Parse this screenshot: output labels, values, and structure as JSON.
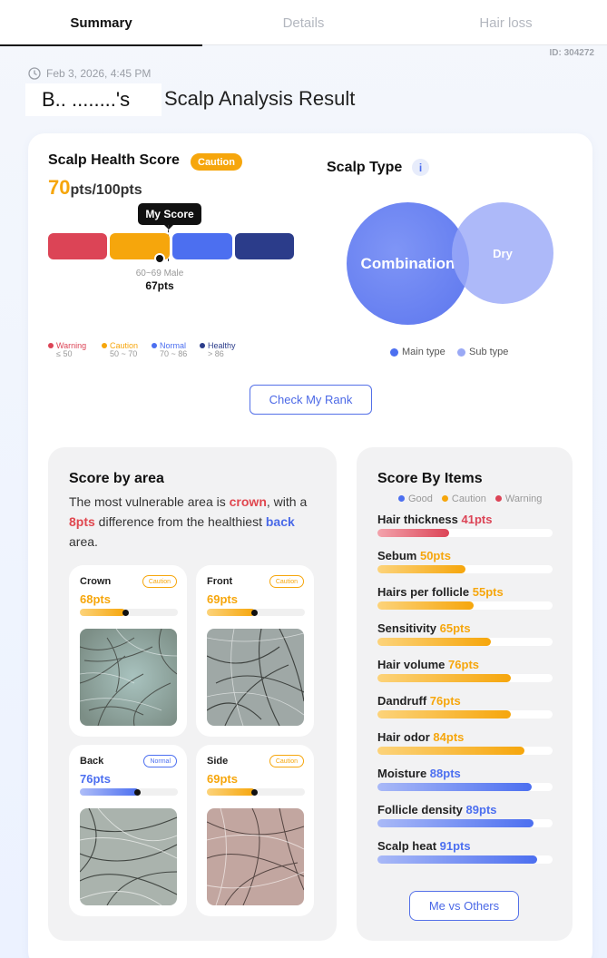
{
  "tabs": [
    {
      "label": "Summary",
      "active": true
    },
    {
      "label": "Details",
      "active": false
    },
    {
      "label": "Hair loss",
      "active": false
    }
  ],
  "id_text": "ID: 304272",
  "date": "Feb 3, 2026, 4:45 PM",
  "user_name": "B.. ........'s",
  "result_title": "Scalp Analysis Result",
  "health": {
    "title": "Scalp Health Score",
    "badge": "Caution",
    "score_value": "70",
    "score_suffix": "pts/100pts",
    "my_score_label": "My Score",
    "avg_group": "60~69 Male",
    "avg_value": "67pts",
    "legend": [
      {
        "label": "Warning",
        "range": "≤ 50",
        "color": "#dc4456"
      },
      {
        "label": "Caution",
        "range": "50 ~ 70",
        "color": "#f6a60c"
      },
      {
        "label": "Normal",
        "range": "70 ~ 86",
        "color": "#4c6ff0"
      },
      {
        "label": "Healthy",
        "range": "> 86",
        "color": "#2b3c8a"
      }
    ]
  },
  "scalp_type": {
    "title": "Scalp Type",
    "info_icon": "i",
    "main": "Combination",
    "sub": "Dry",
    "legend_main": "Main type",
    "legend_sub": "Sub type"
  },
  "rank_button": "Check My Rank",
  "area": {
    "title": "Score by area",
    "desc_1": "The most vulnerable area is ",
    "desc_worst": "crown",
    "desc_2": ", with a ",
    "desc_diff": "8pts",
    "desc_3": " difference from the healthiest ",
    "desc_best": "back",
    "desc_4": " area.",
    "boxes": [
      {
        "name": "Crown",
        "badge": "Caution",
        "score": "68pts",
        "value": 68
      },
      {
        "name": "Front",
        "badge": "Caution",
        "score": "69pts",
        "value": 69
      },
      {
        "name": "Back",
        "badge": "Normal",
        "score": "76pts",
        "value": 76
      },
      {
        "name": "Side",
        "badge": "Caution",
        "score": "69pts",
        "value": 69
      }
    ]
  },
  "items": {
    "title": "Score By Items",
    "legend": [
      {
        "label": "Good",
        "color": "#4c6ff0"
      },
      {
        "label": "Caution",
        "color": "#f6a60c"
      },
      {
        "label": "Warning",
        "color": "#dc4456"
      }
    ],
    "list": [
      {
        "name": "Hair thickness",
        "score": "41pts",
        "value": 41,
        "status": "warning"
      },
      {
        "name": "Sebum",
        "score": "50pts",
        "value": 50,
        "status": "caution"
      },
      {
        "name": "Hairs per follicle",
        "score": "55pts",
        "value": 55,
        "status": "caution"
      },
      {
        "name": "Sensitivity",
        "score": "65pts",
        "value": 65,
        "status": "caution"
      },
      {
        "name": "Hair volume",
        "score": "76pts",
        "value": 76,
        "status": "caution"
      },
      {
        "name": "Dandruff",
        "score": "76pts",
        "value": 76,
        "status": "caution"
      },
      {
        "name": "Hair odor",
        "score": "84pts",
        "value": 84,
        "status": "caution"
      },
      {
        "name": "Moisture",
        "score": "88pts",
        "value": 88,
        "status": "good"
      },
      {
        "name": "Follicle density",
        "score": "89pts",
        "value": 89,
        "status": "good"
      },
      {
        "name": "Scalp heat",
        "score": "91pts",
        "value": 91,
        "status": "good"
      }
    ]
  },
  "vs_button": "Me vs Others",
  "colors": {
    "warning": "#dc4456",
    "caution": "#f6a60c",
    "normal": "#4c6ff0",
    "healthy": "#2b3c8a"
  }
}
